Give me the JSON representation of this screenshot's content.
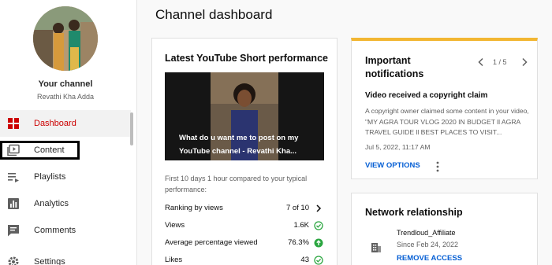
{
  "sidebar": {
    "your_channel": "Your channel",
    "channel_name": "Revathi Kha Adda",
    "items": [
      {
        "label": "Dashboard",
        "icon": "dashboard-icon",
        "active": true
      },
      {
        "label": "Content",
        "icon": "content-icon"
      },
      {
        "label": "Playlists",
        "icon": "playlists-icon"
      },
      {
        "label": "Analytics",
        "icon": "analytics-icon"
      },
      {
        "label": "Comments",
        "icon": "comments-icon"
      },
      {
        "label": "Settings",
        "icon": "settings-icon"
      }
    ]
  },
  "main": {
    "title": "Channel dashboard"
  },
  "short_card": {
    "title": "Latest YouTube Short performance",
    "video_caption": "What do u want me to post on my YouTube channel - Revathi Kha...",
    "description": "First 10 days 1 hour compared to your typical performance:",
    "rows": [
      {
        "label": "Ranking by views",
        "value": "7 of 10",
        "icon": "chevron-right-icon"
      },
      {
        "label": "Views",
        "value": "1.6K",
        "icon": "check-circle-icon"
      },
      {
        "label": "Average percentage viewed",
        "value": "76.3%",
        "icon": "arrow-up-circle-icon"
      },
      {
        "label": "Likes",
        "value": "43",
        "icon": "check-circle-icon"
      }
    ]
  },
  "notifications_card": {
    "title": "Important notifications",
    "pager": "1 / 5",
    "headline": "Video received a copyright claim",
    "body": "A copyright owner claimed some content in your video, \"MY AGRA TOUR VLOG 2020 IN BUDGET ll AGRA TRAVEL GUIDE ll BEST PLACES TO VISIT...",
    "date": "Jul 5, 2022, 11:17 AM",
    "action": "VIEW OPTIONS"
  },
  "network_card": {
    "title": "Network relationship",
    "partner": "Trendloud_Affiliate",
    "since": "Since Feb 24, 2022",
    "action": "REMOVE ACCESS"
  },
  "colors": {
    "accent_red": "#cc0000",
    "link_blue": "#065fd4",
    "notice_yellow": "#f2b632",
    "success_green": "#2ba640"
  }
}
